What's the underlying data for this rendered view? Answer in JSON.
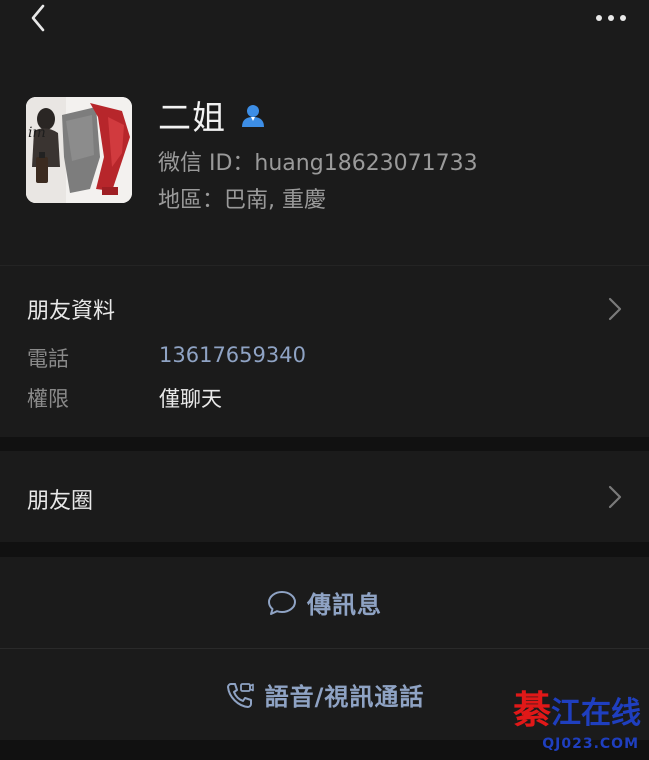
{
  "profile": {
    "name": "二姐",
    "wechat_id": "微信 ID：huang18623071733",
    "region": "地區：巴南, 重慶"
  },
  "friend_info": {
    "title": "朋友資料",
    "rows": [
      {
        "label": "電話",
        "value": "13617659340"
      },
      {
        "label": "權限",
        "value": "僅聊天"
      }
    ]
  },
  "moments": {
    "label": "朋友圈"
  },
  "actions": {
    "message_label": "傳訊息",
    "call_label": "語音/視訊通話"
  },
  "watermark": {
    "first_char": "綦",
    "rest": "江在线",
    "domain": "QJ023.COM"
  },
  "icons": {
    "back": "back-chevron-icon",
    "more": "more-dots-icon",
    "person": "contact-person-icon",
    "chevron": "chevron-right-icon",
    "message": "message-bubble-icon",
    "call": "phone-video-call-icon"
  },
  "colors": {
    "background": "#111111",
    "panel": "#1b1b1b",
    "accent_link": "#8fa3c4",
    "person_icon": "#3d8ee6",
    "watermark_red": "#e01818",
    "watermark_blue": "#1f3fbf"
  }
}
